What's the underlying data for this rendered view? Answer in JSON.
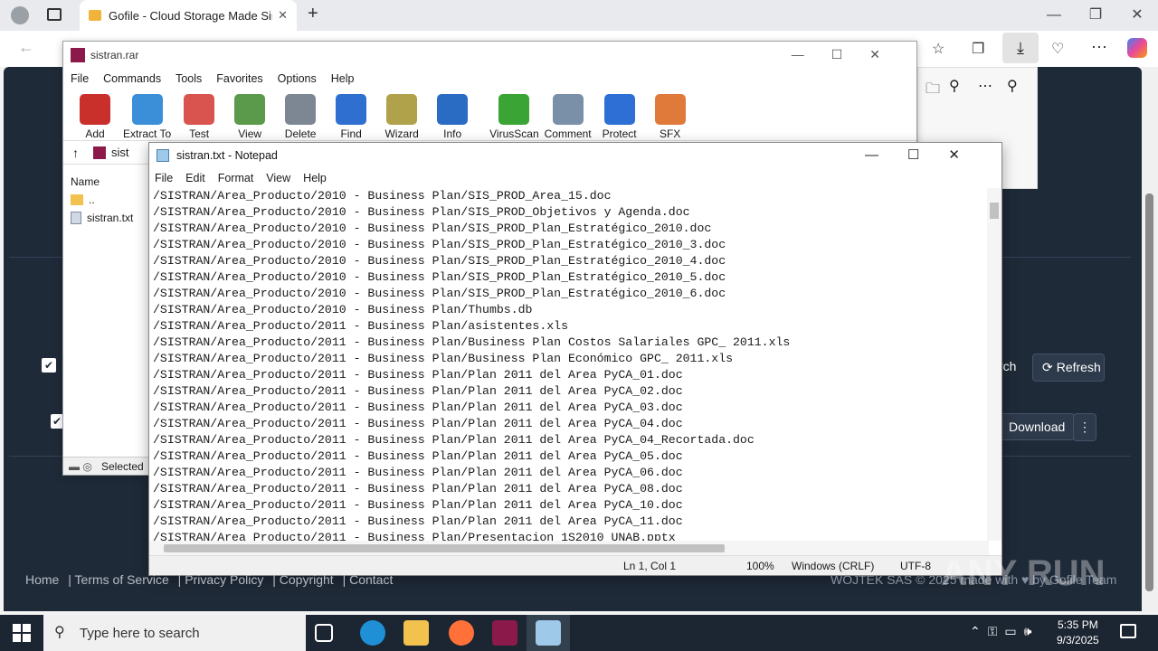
{
  "browser": {
    "tab_title": "Gofile - Cloud Storage Made Simple",
    "new_tab": "+",
    "window_controls": [
      "—",
      "❐",
      "✕"
    ]
  },
  "winrar": {
    "title": "sistran.rar",
    "menu": [
      "File",
      "Commands",
      "Tools",
      "Favorites",
      "Options",
      "Help"
    ],
    "tools": [
      {
        "label": "Add",
        "color": "#c9302c"
      },
      {
        "label": "Extract To",
        "color": "#3b8ed8"
      },
      {
        "label": "Test",
        "color": "#d9534f"
      },
      {
        "label": "View",
        "color": "#5a9a4a"
      },
      {
        "label": "Delete",
        "color": "#7d8793"
      },
      {
        "label": "Find",
        "color": "#2f6fd0"
      },
      {
        "label": "Wizard",
        "color": "#b0a24a"
      },
      {
        "label": "Info",
        "color": "#2a6cc4"
      },
      {
        "label": "VirusScan",
        "color": "#3aa535"
      },
      {
        "label": "Comment",
        "color": "#7a8fa8"
      },
      {
        "label": "Protect",
        "color": "#2e6fd6"
      },
      {
        "label": "SFX",
        "color": "#e07a3a"
      }
    ],
    "address": "sist",
    "list_header": "Name",
    "list_items": [
      "..",
      "sistran.txt"
    ],
    "status": "Selected"
  },
  "notepad": {
    "title": "sistran.txt - Notepad",
    "menu": [
      "File",
      "Edit",
      "Format",
      "View",
      "Help"
    ],
    "lines": [
      "/SISTRAN/Area_Producto/2010 - Business Plan/SIS_PROD_Area_15.doc",
      "/SISTRAN/Area_Producto/2010 - Business Plan/SIS_PROD_Objetivos y Agenda.doc",
      "/SISTRAN/Area_Producto/2010 - Business Plan/SIS_PROD_Plan_Estratégico_2010.doc",
      "/SISTRAN/Area_Producto/2010 - Business Plan/SIS_PROD_Plan_Estratégico_2010_3.doc",
      "/SISTRAN/Area_Producto/2010 - Business Plan/SIS_PROD_Plan_Estratégico_2010_4.doc",
      "/SISTRAN/Area_Producto/2010 - Business Plan/SIS_PROD_Plan_Estratégico_2010_5.doc",
      "/SISTRAN/Area_Producto/2010 - Business Plan/SIS_PROD_Plan_Estratégico_2010_6.doc",
      "/SISTRAN/Area_Producto/2010 - Business Plan/Thumbs.db",
      "/SISTRAN/Area_Producto/2011 - Business Plan/asistentes.xls",
      "/SISTRAN/Area_Producto/2011 - Business Plan/Business Plan Costos Salariales GPC_ 2011.xls",
      "/SISTRAN/Area_Producto/2011 - Business Plan/Business Plan Económico GPC_ 2011.xls",
      "/SISTRAN/Area_Producto/2011 - Business Plan/Plan 2011 del Area PyCA_01.doc",
      "/SISTRAN/Area_Producto/2011 - Business Plan/Plan 2011 del Area PyCA_02.doc",
      "/SISTRAN/Area_Producto/2011 - Business Plan/Plan 2011 del Area PyCA_03.doc",
      "/SISTRAN/Area_Producto/2011 - Business Plan/Plan 2011 del Area PyCA_04.doc",
      "/SISTRAN/Area_Producto/2011 - Business Plan/Plan 2011 del Area PyCA_04_Recortada.doc",
      "/SISTRAN/Area_Producto/2011 - Business Plan/Plan 2011 del Area PyCA_05.doc",
      "/SISTRAN/Area_Producto/2011 - Business Plan/Plan 2011 del Area PyCA_06.doc",
      "/SISTRAN/Area_Producto/2011 - Business Plan/Plan 2011 del Area PyCA_08.doc",
      "/SISTRAN/Area_Producto/2011 - Business Plan/Plan 2011 del Area PyCA_10.doc",
      "/SISTRAN/Area_Producto/2011 - Business Plan/Plan 2011 del Area PyCA_11.doc",
      "/SISTRAN/Area_Producto/2011 - Business Plan/Presentacion 1S2010 UNAB.pptx"
    ],
    "status": {
      "position": "Ln 1, Col 1",
      "zoom": "100%",
      "eol": "Windows (CRLF)",
      "encoding": "UTF-8"
    }
  },
  "page": {
    "refresh": "Refresh",
    "search_partial": "rch",
    "download": "Download",
    "footer_links": [
      "Home",
      "Terms of Service",
      "Privacy Policy",
      "Copyright",
      "Contact"
    ],
    "footer_right": "WOJTEK SAS © 2025 made with ♥ by Gofile Team",
    "watermark": "ANY RUN"
  },
  "taskbar": {
    "search_placeholder": "Type here to search",
    "time": "5:35 PM",
    "date": "9/3/2025"
  }
}
